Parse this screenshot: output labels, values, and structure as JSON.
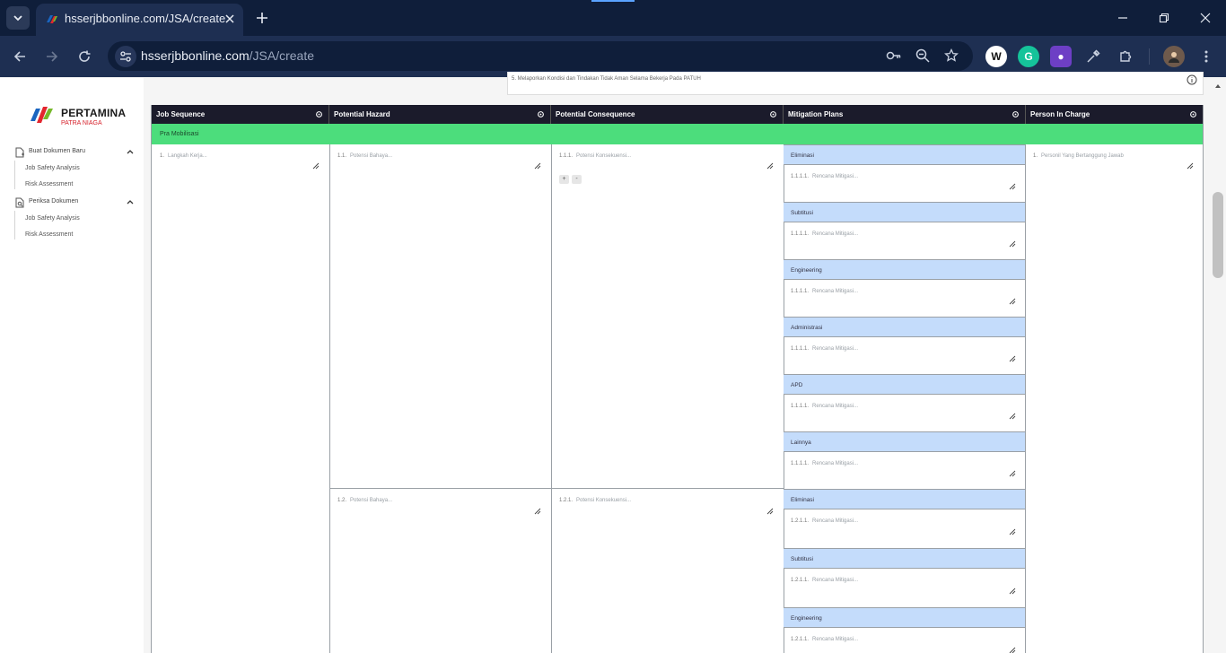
{
  "browser": {
    "tab_title": "hsserjbbonline.com/JSA/create",
    "url_host": "hsserjbbonline.com",
    "url_path": "/JSA/create"
  },
  "sidebar": {
    "logo_text": "PERTAMINA",
    "logo_sub": "PATRA NIAGA",
    "groups": [
      {
        "label": "Buat Dokumen Baru",
        "items": [
          "Job Safety Analysis",
          "Risk Assessment"
        ]
      },
      {
        "label": "Periksa Dokumen",
        "items": [
          "Job Safety Analysis",
          "Risk Assessment"
        ]
      }
    ]
  },
  "rule_text": "5.    Melaporkan Kondisi dan Tindakan Tidak Aman Selama Bekerja Pada PATUH",
  "table": {
    "headers": [
      "Job Sequence",
      "Potential Hazard",
      "Potential Consequence",
      "Mitigation Plans",
      "Person In Charge"
    ],
    "phase": "Pra Mobilisasi",
    "job_step": {
      "num": "1.",
      "placeholder": "Langkah Kerja..."
    },
    "hazards": [
      {
        "num": "1.1.",
        "placeholder": "Potensi Bahaya..."
      },
      {
        "num": "1.2.",
        "placeholder": "Potensi Bahaya..."
      }
    ],
    "consequences": [
      {
        "num": "1.1.1.",
        "placeholder": "Potensi Konsekuensi..."
      },
      {
        "num": "1.2.1.",
        "placeholder": "Potensi Konsekuensi..."
      }
    ],
    "add_btn": "+",
    "remove_btn": "-",
    "mitigation_categories": [
      "Eliminasi",
      "Subtitusi",
      "Engineering",
      "Administrasi",
      "APD",
      "Lainnya",
      "Eliminasi",
      "Subtitusi",
      "Engineering"
    ],
    "mitigation_nums": [
      "1.1.1.1.",
      "1.1.1.1.",
      "1.1.1.1.",
      "1.1.1.1.",
      "1.1.1.1.",
      "1.1.1.1.",
      "1.2.1.1.",
      "1.2.1.1.",
      "1.2.1.1."
    ],
    "mitigation_placeholder": "Rencana Mitigasi...",
    "pic": {
      "num": "1.",
      "placeholder": "Personil Yang Bertanggung Jawab"
    }
  }
}
